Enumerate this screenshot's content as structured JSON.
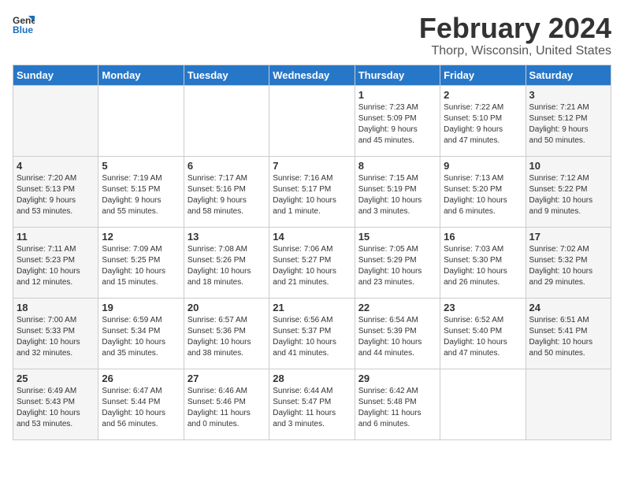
{
  "header": {
    "logo_general": "General",
    "logo_blue": "Blue",
    "title": "February 2024",
    "subtitle": "Thorp, Wisconsin, United States"
  },
  "days_of_week": [
    "Sunday",
    "Monday",
    "Tuesday",
    "Wednesday",
    "Thursday",
    "Friday",
    "Saturday"
  ],
  "weeks": [
    [
      {
        "day": "",
        "info": ""
      },
      {
        "day": "",
        "info": ""
      },
      {
        "day": "",
        "info": ""
      },
      {
        "day": "",
        "info": ""
      },
      {
        "day": "1",
        "info": "Sunrise: 7:23 AM\nSunset: 5:09 PM\nDaylight: 9 hours\nand 45 minutes."
      },
      {
        "day": "2",
        "info": "Sunrise: 7:22 AM\nSunset: 5:10 PM\nDaylight: 9 hours\nand 47 minutes."
      },
      {
        "day": "3",
        "info": "Sunrise: 7:21 AM\nSunset: 5:12 PM\nDaylight: 9 hours\nand 50 minutes."
      }
    ],
    [
      {
        "day": "4",
        "info": "Sunrise: 7:20 AM\nSunset: 5:13 PM\nDaylight: 9 hours\nand 53 minutes."
      },
      {
        "day": "5",
        "info": "Sunrise: 7:19 AM\nSunset: 5:15 PM\nDaylight: 9 hours\nand 55 minutes."
      },
      {
        "day": "6",
        "info": "Sunrise: 7:17 AM\nSunset: 5:16 PM\nDaylight: 9 hours\nand 58 minutes."
      },
      {
        "day": "7",
        "info": "Sunrise: 7:16 AM\nSunset: 5:17 PM\nDaylight: 10 hours\nand 1 minute."
      },
      {
        "day": "8",
        "info": "Sunrise: 7:15 AM\nSunset: 5:19 PM\nDaylight: 10 hours\nand 3 minutes."
      },
      {
        "day": "9",
        "info": "Sunrise: 7:13 AM\nSunset: 5:20 PM\nDaylight: 10 hours\nand 6 minutes."
      },
      {
        "day": "10",
        "info": "Sunrise: 7:12 AM\nSunset: 5:22 PM\nDaylight: 10 hours\nand 9 minutes."
      }
    ],
    [
      {
        "day": "11",
        "info": "Sunrise: 7:11 AM\nSunset: 5:23 PM\nDaylight: 10 hours\nand 12 minutes."
      },
      {
        "day": "12",
        "info": "Sunrise: 7:09 AM\nSunset: 5:25 PM\nDaylight: 10 hours\nand 15 minutes."
      },
      {
        "day": "13",
        "info": "Sunrise: 7:08 AM\nSunset: 5:26 PM\nDaylight: 10 hours\nand 18 minutes."
      },
      {
        "day": "14",
        "info": "Sunrise: 7:06 AM\nSunset: 5:27 PM\nDaylight: 10 hours\nand 21 minutes."
      },
      {
        "day": "15",
        "info": "Sunrise: 7:05 AM\nSunset: 5:29 PM\nDaylight: 10 hours\nand 23 minutes."
      },
      {
        "day": "16",
        "info": "Sunrise: 7:03 AM\nSunset: 5:30 PM\nDaylight: 10 hours\nand 26 minutes."
      },
      {
        "day": "17",
        "info": "Sunrise: 7:02 AM\nSunset: 5:32 PM\nDaylight: 10 hours\nand 29 minutes."
      }
    ],
    [
      {
        "day": "18",
        "info": "Sunrise: 7:00 AM\nSunset: 5:33 PM\nDaylight: 10 hours\nand 32 minutes."
      },
      {
        "day": "19",
        "info": "Sunrise: 6:59 AM\nSunset: 5:34 PM\nDaylight: 10 hours\nand 35 minutes."
      },
      {
        "day": "20",
        "info": "Sunrise: 6:57 AM\nSunset: 5:36 PM\nDaylight: 10 hours\nand 38 minutes."
      },
      {
        "day": "21",
        "info": "Sunrise: 6:56 AM\nSunset: 5:37 PM\nDaylight: 10 hours\nand 41 minutes."
      },
      {
        "day": "22",
        "info": "Sunrise: 6:54 AM\nSunset: 5:39 PM\nDaylight: 10 hours\nand 44 minutes."
      },
      {
        "day": "23",
        "info": "Sunrise: 6:52 AM\nSunset: 5:40 PM\nDaylight: 10 hours\nand 47 minutes."
      },
      {
        "day": "24",
        "info": "Sunrise: 6:51 AM\nSunset: 5:41 PM\nDaylight: 10 hours\nand 50 minutes."
      }
    ],
    [
      {
        "day": "25",
        "info": "Sunrise: 6:49 AM\nSunset: 5:43 PM\nDaylight: 10 hours\nand 53 minutes."
      },
      {
        "day": "26",
        "info": "Sunrise: 6:47 AM\nSunset: 5:44 PM\nDaylight: 10 hours\nand 56 minutes."
      },
      {
        "day": "27",
        "info": "Sunrise: 6:46 AM\nSunset: 5:46 PM\nDaylight: 11 hours\nand 0 minutes."
      },
      {
        "day": "28",
        "info": "Sunrise: 6:44 AM\nSunset: 5:47 PM\nDaylight: 11 hours\nand 3 minutes."
      },
      {
        "day": "29",
        "info": "Sunrise: 6:42 AM\nSunset: 5:48 PM\nDaylight: 11 hours\nand 6 minutes."
      },
      {
        "day": "",
        "info": ""
      },
      {
        "day": "",
        "info": ""
      }
    ]
  ]
}
